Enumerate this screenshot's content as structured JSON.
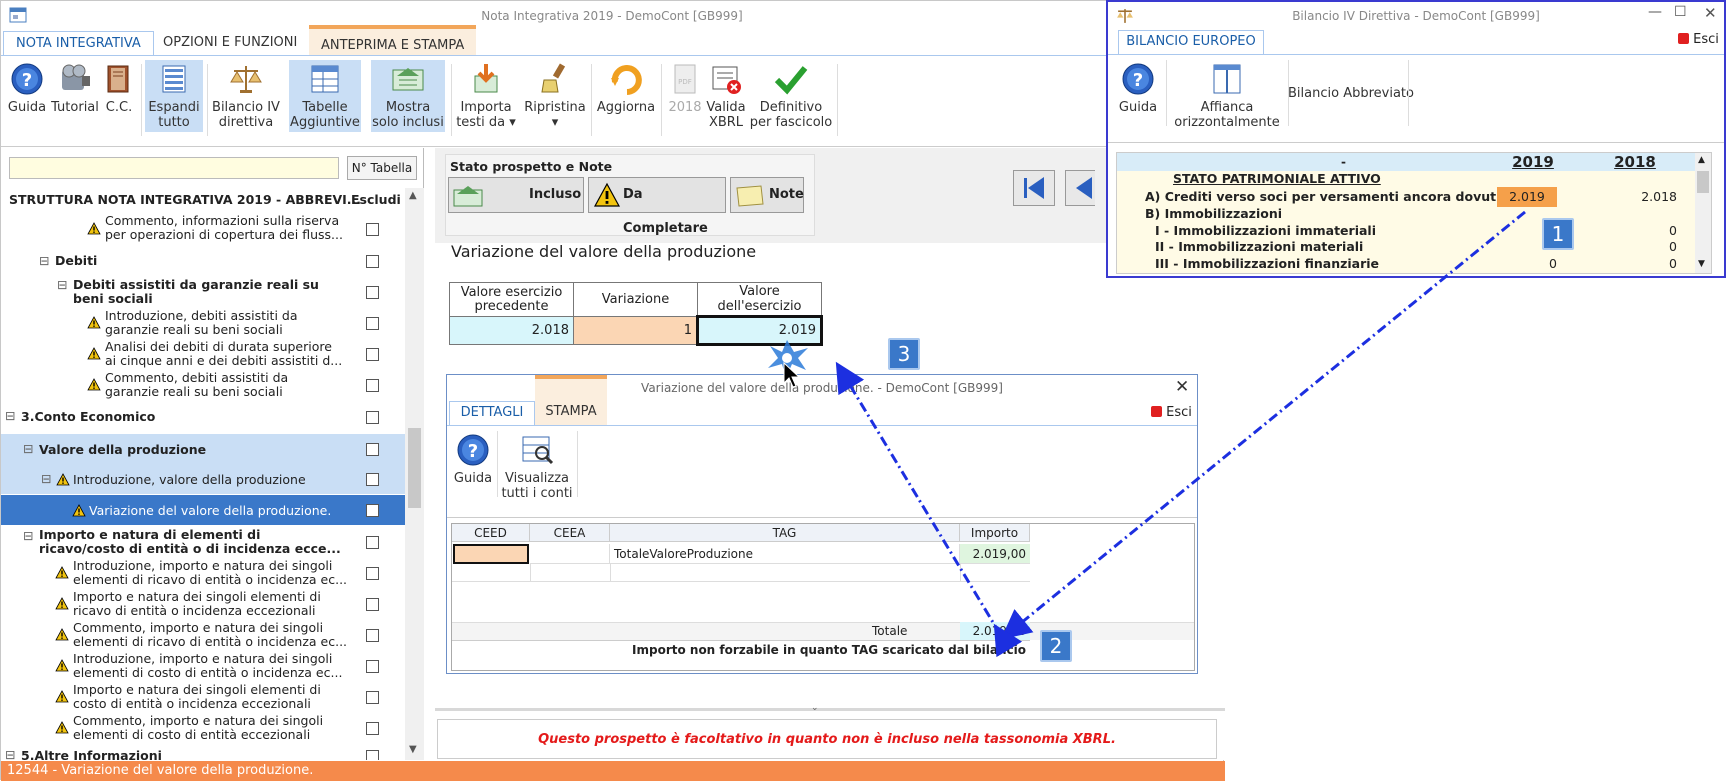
{
  "main_window": {
    "title": "Nota Integrativa 2019 - DemoCont [GB999]",
    "tabs": [
      "NOTA INTEGRATIVA",
      "OPZIONI E FUNZIONI",
      "ANTEPRIMA E STAMPA"
    ],
    "ribbon": {
      "guida": "Guida",
      "tutorial": "Tutorial",
      "cc": "C.C.",
      "espandi_1": "Espandi",
      "espandi_2": "tutto",
      "bilancio_1": "Bilancio IV",
      "bilancio_2": "direttiva",
      "tabelle_1": "Tabelle",
      "tabelle_2": "Aggiuntive",
      "mostra_1": "Mostra",
      "mostra_2": "solo inclusi",
      "importa_1": "Importa",
      "importa_2": "testi da",
      "ripristina": "Ripristina",
      "aggiorna": "Aggiorna",
      "anno": "2018",
      "valida_1": "Valida",
      "valida_2": "XBRL",
      "definitivo_1": "Definitivo",
      "definitivo_2": "per fascicolo"
    }
  },
  "left_panel": {
    "search_value": "",
    "n_tabella_label": "N° Tabella",
    "header_title": "STRUTTURA NOTA INTEGRATIVA 2019 - ABBREVI...",
    "header_escludi": "Escludi",
    "rows": [
      {
        "l1": "Commento, informazioni sulla riserva",
        "l2": "per operazioni di copertura dei fluss..."
      },
      {
        "l1": "Debiti"
      },
      {
        "l1": "Debiti assistiti da garanzie reali su",
        "l2": "beni sociali"
      },
      {
        "l1": "Introduzione, debiti assistiti da",
        "l2": "garanzie reali su beni sociali"
      },
      {
        "l1": "Analisi dei debiti di durata superiore",
        "l2": "ai cinque anni e dei debiti assistiti d..."
      },
      {
        "l1": "Commento, debiti assistiti da",
        "l2": "garanzie reali su beni sociali"
      },
      {
        "l1": "3.Conto Economico"
      },
      {
        "l1": "Valore della produzione"
      },
      {
        "l1": "Introduzione, valore della produzione"
      },
      {
        "l1": "Variazione del valore della produzione."
      },
      {
        "l1": "Importo e natura di elementi di",
        "l2": "ricavo/costo di entità o di incidenza ecce..."
      },
      {
        "l1": "Introduzione, importo e natura dei singoli",
        "l2": "elementi di ricavo di entità o incidenza ec..."
      },
      {
        "l1": "Importo e natura dei singoli elementi di",
        "l2": "ricavo di entità o incidenza eccezionali"
      },
      {
        "l1": "Commento, importo e natura dei singoli",
        "l2": "elementi di ricavo di entità o incidenza ec..."
      },
      {
        "l1": "Introduzione, importo e natura dei singoli",
        "l2": "elementi di costo di entità o incidenza ec..."
      },
      {
        "l1": "Importo e natura dei singoli elementi di",
        "l2": "costo di entità o incidenza eccezionali"
      },
      {
        "l1": "Commento, importo e natura dei singoli",
        "l2": "elementi di costo di entità eccezionali"
      },
      {
        "l1": "5.Altre Informazioni"
      }
    ]
  },
  "status_bar": "12544 - Variazione del valore della produzione.",
  "stato_prospetto": {
    "title": "Stato prospetto e Note",
    "incluso": "Incluso",
    "da_completare": "Da Completare",
    "note": "Note"
  },
  "section_title": "Variazione del valore della produzione",
  "main_table": {
    "col1_l1": "Valore esercizio",
    "col1_l2": "precedente",
    "col2": "Variazione",
    "col3": "Valore dell'esercizio",
    "v1": "2.018",
    "v2": "1",
    "v3": "2.019"
  },
  "detail_dialog": {
    "title": "Variazione del valore della produzione. - DemoCont [GB999]",
    "tabs": [
      "DETTAGLI",
      "STAMPA"
    ],
    "esci": "Esci",
    "guida": "Guida",
    "visualizza_1": "Visualizza",
    "visualizza_2": "tutti i conti",
    "columns": [
      "CEED",
      "CEEA",
      "TAG",
      "Importo"
    ],
    "row_tag": "TotaleValoreProduzione",
    "row_importo": "2.019,00",
    "totale_label": "Totale",
    "totale_value": "2.019,00",
    "footer_note": "Importo non forzabile in quanto TAG scaricato dal bilancio"
  },
  "hint_text": "Questo prospetto è facoltativo in quanto non è incluso nella tassonomia XBRL.",
  "side_window": {
    "title": "Bilancio IV Direttiva - DemoCont [GB999]",
    "tab": "BILANCIO EUROPEO",
    "esci": "Esci",
    "guida": "Guida",
    "affianca_1": "Affianca",
    "affianca_2": "orizzontalmente",
    "abbreviato": "Bilancio Abbreviato",
    "year_a": "2019",
    "year_b": "2018",
    "sp_title": "STATO PATRIMONIALE ATTIVO",
    "rows": [
      {
        "label": "A) Crediti verso soci per versamenti ancora dovuti",
        "a": "2.019",
        "b": "2.018"
      },
      {
        "label": "B) Immobilizzazioni",
        "a": "",
        "b": ""
      },
      {
        "label": "I - Immobilizzazioni immateriali",
        "a": "",
        "b": "0"
      },
      {
        "label": "II - Immobilizzazioni materiali",
        "a": "",
        "b": "0"
      },
      {
        "label": "III - Immobilizzazioni finanziarie",
        "a": "0",
        "b": "0"
      }
    ]
  },
  "callouts": [
    "1",
    "2",
    "3"
  ],
  "colors": {
    "accent": "#1a5ea8",
    "highlight_orange": "#f5a04a",
    "status_orange": "#f58a4b",
    "selection_blue": "#3a78c9",
    "arrow_blue": "#1c2fe0",
    "hint_red": "#e41a1a"
  }
}
